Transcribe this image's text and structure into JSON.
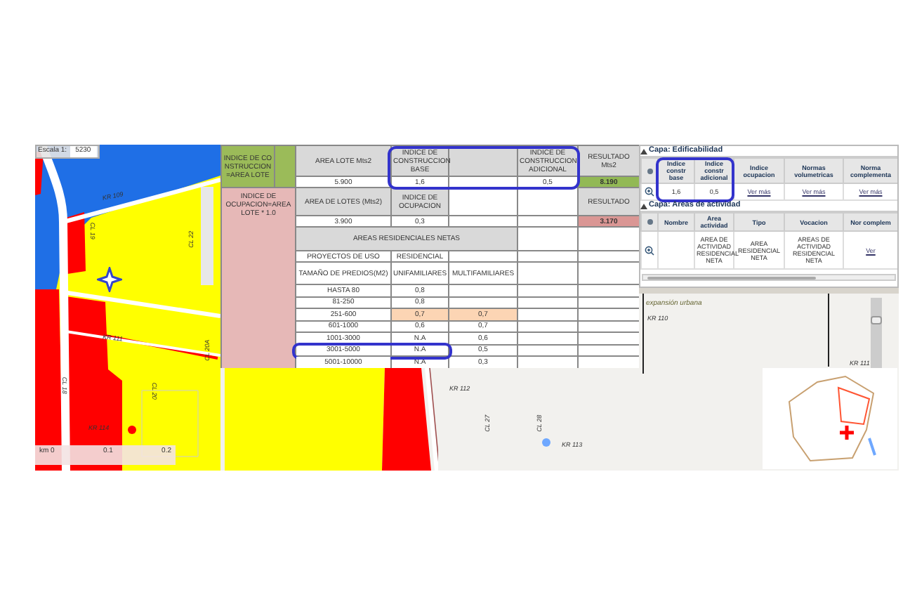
{
  "zoning_map": {
    "scale": {
      "label": "Escala 1:",
      "value": "5230"
    },
    "street_labels": [
      "KR 109",
      "CL 19",
      "CL 22",
      "KR 111",
      "CL 20A",
      "CL 18",
      "CL 20",
      "KR 114"
    ],
    "scale_bar": [
      "km 0",
      "0.1",
      "0.2"
    ]
  },
  "calc_table": {
    "construction": {
      "formula": "INDICE DE CONSTRUCCION=AREA LOTE",
      "area_header": "AREA LOTE Mts2",
      "base_header": "INDICE DE CONSTRUCCION BASE",
      "additional_header": "INDICE DE CONSTRUCCION ADICIONAL",
      "result_header": "RESULTADO Mts2",
      "area": "5.900",
      "base": "1,6",
      "additional": "0,5",
      "result": "8.190",
      "circled": true
    },
    "occupation": {
      "formula": "INDICE DE OCUPACION=AREA LOTE * 1.0",
      "area_header": "AREA DE LOTES (Mts2)",
      "index_header": "INDICE DE OCUPACION",
      "result_header": "RESULTADO",
      "area": "3.900",
      "index": "0,3",
      "result": "3.170"
    },
    "residential": {
      "title": "AREAS RESIDENCIALES NETAS",
      "use_label": "PROYECTOS DE USO",
      "use_value": "RESIDENCIAL",
      "size_header": "TAMAÑO DE PREDIOS(M2)",
      "single_header": "UNIFAMILIARES",
      "multi_header": "MULTIFAMILIARES",
      "rows": [
        {
          "size": "HASTA 80",
          "single": "0,8",
          "highlighted": false,
          "circled": false
        },
        {
          "size": "81-250",
          "single": "0,8",
          "highlighted": false,
          "circled": false
        },
        {
          "size": "251-600",
          "single": "0,7",
          "multi": "0,7",
          "highlighted": true,
          "circled": false
        },
        {
          "size": "601-1000",
          "single": "0,6",
          "multi": "0,7",
          "highlighted": false,
          "circled": false
        },
        {
          "size": "1001-3000",
          "single": "N.A",
          "multi": "0,6",
          "highlighted": false,
          "circled": false
        },
        {
          "size": "3001-5000",
          "single": "N.A",
          "multi": "0,5",
          "highlighted": false,
          "circled": true
        },
        {
          "size": "5001-10000",
          "single": "N.A",
          "multi": "0,3",
          "highlighted": false,
          "circled": false
        }
      ]
    }
  },
  "street_map": {
    "labels": [
      "KR 112",
      "CL 27",
      "CL 28",
      "KR 113"
    ]
  },
  "info_panel": {
    "layers": [
      {
        "title": "Capa: Edificabilidad",
        "expanded": true,
        "circled": true,
        "columns": [
          "Indice constr base",
          "Indice constr adicional",
          "Indice ocupacion",
          "Normas volumetricas",
          "Norma complementa"
        ],
        "cells": [
          {
            "kind": "text",
            "text": "1,6"
          },
          {
            "kind": "text",
            "text": "0,5"
          },
          {
            "kind": "link",
            "text": "Ver más"
          },
          {
            "kind": "link",
            "text": "Ver más"
          },
          {
            "kind": "link",
            "text": "Ver más"
          }
        ]
      },
      {
        "title": "Capa: Areas de actividad",
        "expanded": true,
        "columns": [
          "Nombre",
          "Area actividad",
          "Tipo",
          "Vocacion",
          "Nor complem"
        ],
        "cells": [
          {
            "kind": "empty"
          },
          {
            "kind": "text",
            "text": "AREA DE ACTIVIDAD RESIDENCIAL NETA"
          },
          {
            "kind": "text",
            "text": "AREA RESIDENCIAL NETA"
          },
          {
            "kind": "text",
            "text": "AREAS DE ACTIVIDAD RESIDENCIAL NETA"
          },
          {
            "kind": "link",
            "text": "Ver"
          }
        ]
      }
    ]
  },
  "overview_map": {
    "zone_label": "expansión urbana",
    "labels": [
      "KR 110",
      "KR 111"
    ],
    "zoom": {
      "level": 0.7
    }
  }
}
